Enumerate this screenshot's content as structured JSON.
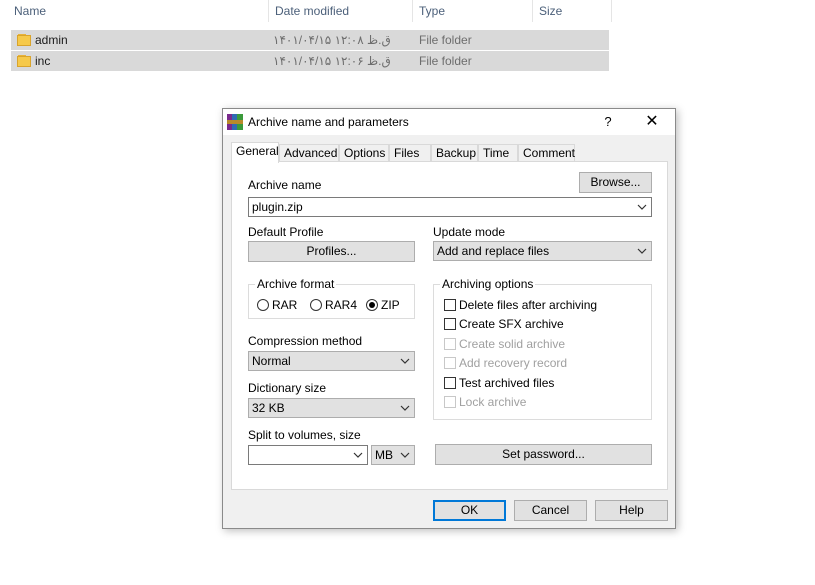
{
  "explorer": {
    "columns": {
      "name": "Name",
      "date_modified": "Date modified",
      "type": "Type",
      "size": "Size"
    },
    "files": [
      {
        "name": "admin",
        "date": "۱۴۰۱/۰۴/۱۵ ق.ظ ۱۲:۰۸",
        "type": "File folder"
      },
      {
        "name": "inc",
        "date": "۱۴۰۱/۰۴/۱۵ ق.ظ ۱۲:۰۶",
        "type": "File folder"
      }
    ]
  },
  "dialog": {
    "title": "Archive name and parameters",
    "help_label": "?",
    "icon": "winrar-archive-icon",
    "tabs": [
      "General",
      "Advanced",
      "Options",
      "Files",
      "Backup",
      "Time",
      "Comment"
    ],
    "active_tab": "General",
    "archive_name_label": "Archive name",
    "browse_label": "Browse...",
    "archive_name_value": "plugin.zip",
    "default_profile_label": "Default Profile",
    "profiles_label": "Profiles...",
    "update_mode_label": "Update mode",
    "update_mode_value": "Add and replace files",
    "archive_format": {
      "title": "Archive format",
      "options": [
        "RAR",
        "RAR4",
        "ZIP"
      ],
      "selected": "ZIP"
    },
    "compression_method_label": "Compression method",
    "compression_method_value": "Normal",
    "dictionary_size_label": "Dictionary size",
    "dictionary_size_value": "32 KB",
    "split_label": "Split to volumes, size",
    "split_value": "",
    "split_unit": "MB",
    "archiving_options": {
      "title": "Archiving options",
      "items": [
        {
          "label": "Delete files after archiving",
          "checked": false,
          "enabled": true
        },
        {
          "label": "Create SFX archive",
          "checked": false,
          "enabled": true
        },
        {
          "label": "Create solid archive",
          "checked": false,
          "enabled": false
        },
        {
          "label": "Add recovery record",
          "checked": false,
          "enabled": false
        },
        {
          "label": "Test archived files",
          "checked": false,
          "enabled": true
        },
        {
          "label": "Lock archive",
          "checked": false,
          "enabled": false
        }
      ]
    },
    "set_password_label": "Set password...",
    "ok_label": "OK",
    "cancel_label": "Cancel",
    "help_button_label": "Help"
  }
}
